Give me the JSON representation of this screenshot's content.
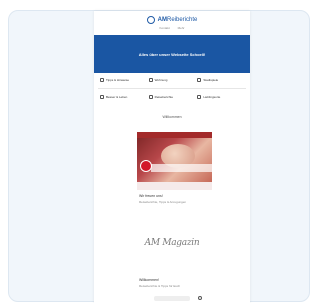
{
  "site": {
    "logo_prefix": "AM",
    "logo_rest": "Reiberichte",
    "nav_links": [
      "Kontakt",
      "Mehr"
    ]
  },
  "banner": {
    "title": "Alles über unser Webseite Schoell!"
  },
  "categories": [
    {
      "label": "Tipps & Hinweise",
      "icon": "check-icon"
    },
    {
      "label": "Wohnung",
      "icon": "home-icon"
    },
    {
      "label": "Stadtspiele",
      "icon": "map-icon"
    },
    {
      "label": "Besser & Leben",
      "icon": "heart-icon"
    },
    {
      "label": "Reiseberichte",
      "icon": "suitcase-icon"
    },
    {
      "label": "Lieblingsorte",
      "icon": "pin-icon"
    }
  ],
  "section": {
    "label": "Willkommen"
  },
  "featured": {
    "title": "Wir freuen uns!",
    "subtitle": "Reiseberichte, Tipps & Anregungen"
  },
  "signature": {
    "text": "AM Magazin"
  },
  "article2": {
    "title": "Willkommen!",
    "subtitle": "Reiseberichte & Tipps für Euch"
  },
  "colors": {
    "brand_blue": "#1a56a3",
    "card_bg": "#f1f6fb",
    "hero_red": "#a32a2a"
  }
}
